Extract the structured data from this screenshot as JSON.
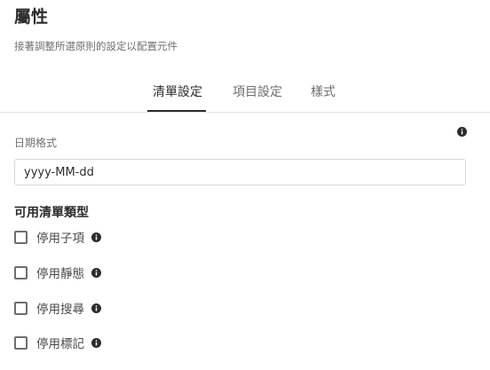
{
  "header": {
    "title": "屬性",
    "subtitle": "接著調整所選原則的設定以配置元件"
  },
  "tabs": [
    {
      "label": "清單設定",
      "active": true
    },
    {
      "label": "項目設定",
      "active": false
    },
    {
      "label": "樣式",
      "active": false
    }
  ],
  "date_format": {
    "label": "日期格式",
    "value": "yyyy-MM-dd",
    "info_icon": "info-icon"
  },
  "list_types": {
    "heading": "可用清單類型",
    "options": [
      {
        "label": "停用子項",
        "checked": false
      },
      {
        "label": "停用靜態",
        "checked": false
      },
      {
        "label": "停用搜尋",
        "checked": false
      },
      {
        "label": "停用標記",
        "checked": false
      }
    ]
  },
  "colors": {
    "text": "#2c2c2c",
    "muted": "#6e6e6e",
    "border": "#d8d8d8"
  }
}
